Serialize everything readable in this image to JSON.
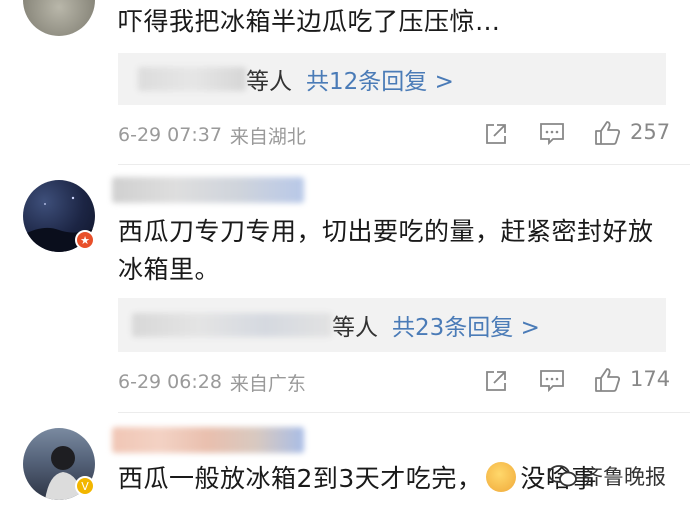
{
  "comments": [
    {
      "text": "吓得我把冰箱半边瓜吃了压压惊…",
      "reply_suffix": "等人",
      "reply_link": "共12条回复 >",
      "time": "6-29 07:37",
      "location": "来自湖北",
      "likes": "257"
    },
    {
      "text_line1": "西瓜刀专刀专用，切出要吃的量，赶紧密封好放",
      "text_line2": "冰箱里。",
      "reply_suffix": "等人",
      "reply_link": "共23条回复 >",
      "time": "6-29 06:28",
      "location": "来自广东",
      "likes": "174"
    },
    {
      "text_before": "西瓜一般放冰箱2到3天才吃完，",
      "text_after": "没啥事"
    }
  ],
  "watermark": {
    "label": "齐鲁晚报"
  },
  "icons": {
    "share": "share-icon",
    "comment": "comment-icon",
    "like": "thumbs-up-icon"
  },
  "colors": {
    "link": "#4a7bb7",
    "meta": "#9a9a9a",
    "reply_bg": "#f2f2f2"
  }
}
